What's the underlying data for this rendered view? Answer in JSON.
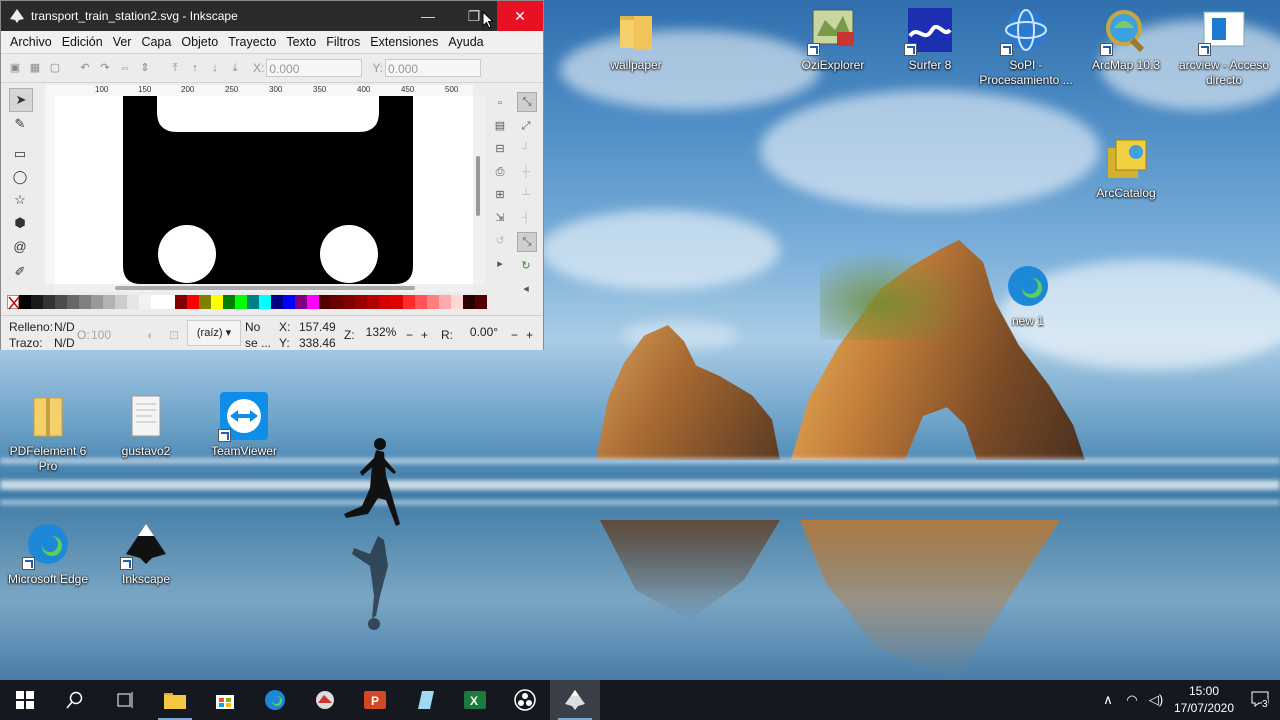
{
  "window": {
    "title": "transport_train_station2.svg - Inkscape",
    "minimize_glyph": "—",
    "maximize_glyph": "❐",
    "close_glyph": "✕"
  },
  "menu": [
    "Archivo",
    "Edición",
    "Ver",
    "Capa",
    "Objeto",
    "Trayecto",
    "Texto",
    "Filtros",
    "Extensiones",
    "Ayuda"
  ],
  "toolbar": {
    "x_label": "X:",
    "x_value": "0.000",
    "y_label": "Y:",
    "y_value": "0.000"
  },
  "ruler_ticks": [
    "100",
    "150",
    "200",
    "250",
    "300",
    "350",
    "400",
    "450",
    "500"
  ],
  "palette_colors": [
    "#000000",
    "#1a1a1a",
    "#333333",
    "#4d4d4d",
    "#666666",
    "#808080",
    "#999999",
    "#b3b3b3",
    "#cccccc",
    "#e6e6e6",
    "#f2f2f2",
    "#ffffff",
    "#ffffff",
    "#800000",
    "#ff0000",
    "#808000",
    "#ffff00",
    "#008000",
    "#00ff00",
    "#008080",
    "#00ffff",
    "#000080",
    "#0000ff",
    "#800080",
    "#ff00ff",
    "#550000",
    "#6a0000",
    "#800000",
    "#9b0000",
    "#b30000",
    "#d40000",
    "#e00000",
    "#ff2a2a",
    "#ff5555",
    "#ff8080",
    "#ffaaaa",
    "#ffd5d5",
    "#2b0000",
    "#550000"
  ],
  "status": {
    "fill_label": "Relleno:",
    "fill_value": "N/D",
    "stroke_label": "Trazo:",
    "stroke_value": "N/D",
    "opacity_label": "O:",
    "opacity_value": "100",
    "layer_value": "(raíz)",
    "message_line1": "No",
    "message_line2": "se ...",
    "x_label": "X:",
    "x_value": "157.49",
    "y_label": "Y:",
    "y_value": "338.46",
    "zoom_label": "Z:",
    "zoom_value": "132%",
    "rotation_label": "R:",
    "rotation_value": "0.00°",
    "minus": "−",
    "plus": "+"
  },
  "desktop_icons": [
    {
      "label": "wallpaper",
      "icon": "folder-icon"
    },
    {
      "label": "OziExplorer",
      "icon": "ozi-icon"
    },
    {
      "label": "Surfer 8",
      "icon": "surfer-icon"
    },
    {
      "label": "SoPI - Procesamiento ...",
      "icon": "globe-icon"
    },
    {
      "label": "ArcMap 10.3",
      "icon": "arcmap-icon"
    },
    {
      "label": "arcview - Acceso directo",
      "icon": "arcview-icon"
    },
    {
      "label": "ArcCatalog",
      "icon": "arccatalog-icon"
    },
    {
      "label": "new 1",
      "icon": "edge-icon"
    },
    {
      "label": "PDFelement 6 Pro",
      "icon": "folder-zip-icon"
    },
    {
      "label": "gustavo2",
      "icon": "document-icon"
    },
    {
      "label": "TeamViewer",
      "icon": "teamviewer-icon"
    },
    {
      "label": "Microsoft Edge",
      "icon": "edge-icon"
    },
    {
      "label": "Inkscape",
      "icon": "inkscape-icon"
    }
  ],
  "taskbar": {
    "items": [
      "start",
      "search",
      "task-view",
      "file-explorer",
      "store",
      "edge",
      "ozi",
      "powerpoint",
      "notepad",
      "excel",
      "obs",
      "inkscape"
    ],
    "time": "15:00",
    "date": "17/07/2020",
    "notification_count": "3"
  },
  "colors": {
    "title_bg": "#2b2b2b",
    "close_red": "#e81123",
    "taskbar_bg": "#15191f"
  }
}
